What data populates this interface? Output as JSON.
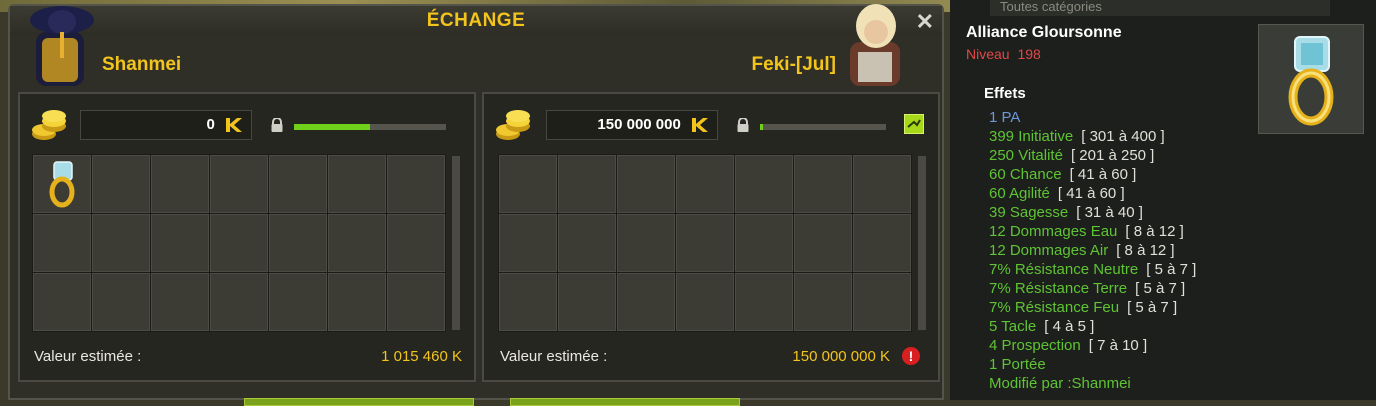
{
  "window": {
    "title": "ÉCHANGE",
    "close_label": "✕"
  },
  "left": {
    "player_name": "Shanmei",
    "kamas": "0",
    "progress": 0.5,
    "value_label": "Valeur estimée :",
    "value_amount": "1 015 460 K"
  },
  "right": {
    "player_name": "Feki-[Jul]",
    "kamas": "150 000 000",
    "progress": 0.02,
    "value_label": "Valeur estimée :",
    "value_amount": "150 000 000 K"
  },
  "tooltip": {
    "top_filter": "Toutes catégories",
    "item_name": "Alliance Gloursonne",
    "level_label": "Niveau",
    "level_value": "198",
    "effects_title": "Effets",
    "effects": [
      {
        "name": "1 PA",
        "range": "",
        "type": "pa"
      },
      {
        "name": "399 Initiative",
        "range": "[ 301 à 400 ]"
      },
      {
        "name": "250 Vitalité",
        "range": "[ 201 à 250 ]"
      },
      {
        "name": "60 Chance",
        "range": "[ 41 à 60 ]"
      },
      {
        "name": "60 Agilité",
        "range": "[ 41 à 60 ]"
      },
      {
        "name": "39 Sagesse",
        "range": "[ 31 à 40 ]"
      },
      {
        "name": "12 Dommages Eau",
        "range": "[ 8 à 12 ]"
      },
      {
        "name": "12 Dommages Air",
        "range": "[ 8 à 12 ]"
      },
      {
        "name": "7% Résistance Neutre",
        "range": "[ 5 à 7 ]"
      },
      {
        "name": "7% Résistance Terre",
        "range": "[ 5 à 7 ]"
      },
      {
        "name": "7% Résistance Feu",
        "range": "[ 5 à 7 ]"
      },
      {
        "name": "5 Tacle",
        "range": "[ 4 à 5 ]"
      },
      {
        "name": "4 Prospection",
        "range": "[ 7 à 10 ]"
      },
      {
        "name": "1 Portée",
        "range": ""
      },
      {
        "name": "Modifié par :Shanmei",
        "range": ""
      }
    ]
  },
  "colors": {
    "accent_gold": "#f2c41c",
    "effect_green": "#5fc433",
    "pa_blue": "#6f96d8",
    "level_red": "#e04848"
  }
}
